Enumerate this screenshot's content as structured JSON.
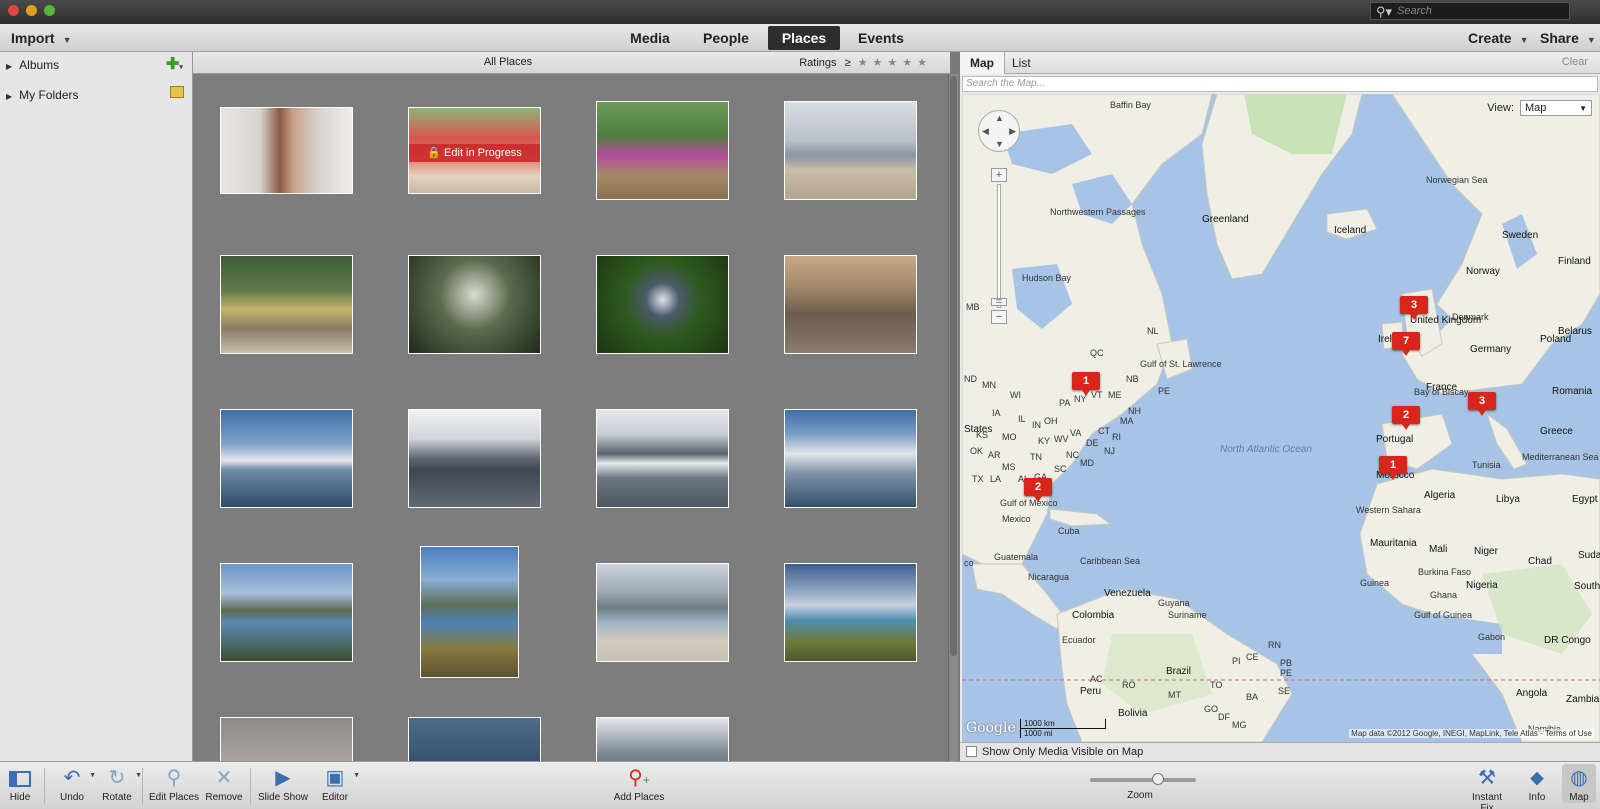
{
  "titlebar": {
    "search_placeholder": "Search"
  },
  "menubar": {
    "import": "Import",
    "tabs": [
      "Media",
      "People",
      "Places",
      "Events"
    ],
    "active_tab": "Places",
    "create": "Create",
    "share": "Share"
  },
  "sidebar": {
    "albums": "Albums",
    "my_folders": "My Folders"
  },
  "grid": {
    "title": "All Places",
    "ratings_label": "Ratings",
    "ratings_op": "≥",
    "stars": "★★★★★",
    "edit_badge": "Edit in Progress"
  },
  "map": {
    "tabs": [
      "Map",
      "List"
    ],
    "clear": "Clear",
    "search_placeholder": "Search the Map...",
    "view_label": "View:",
    "view_value": "Map",
    "labels": {
      "greenland": "Greenland",
      "iceland": "Iceland",
      "sweden": "Sweden",
      "finland": "Finland",
      "norway": "Norway",
      "denmark": "Denmark",
      "united_kingdom": "United Kingdom",
      "ireland": "Ireland",
      "germany": "Germany",
      "poland": "Poland",
      "belarus": "Belarus",
      "france": "France",
      "romania": "Romania",
      "portugal": "Portugal",
      "greece": "Greece",
      "tunisia": "Tunisia",
      "morocco": "Morocco",
      "algeria": "Algeria",
      "libya": "Libya",
      "egypt": "Egypt",
      "western_sahara": "Western Sahara",
      "mauritania": "Mauritania",
      "mali": "Mali",
      "niger": "Niger",
      "chad": "Chad",
      "sudan": "Sudan",
      "south_sudan": "South Sudan",
      "burkina_faso": "Burkina Faso",
      "ghana": "Ghana",
      "nigeria": "Nigeria",
      "guinea": "Guinea",
      "gabon": "Gabon",
      "dr_congo": "DR Congo",
      "angola": "Angola",
      "zambia": "Zambia",
      "namibia": "Namibia",
      "states": "States",
      "mexico": "Mexico",
      "cuba": "Cuba",
      "guatemala": "Guatemala",
      "nicaragua": "Nicaragua",
      "venezuela": "Venezuela",
      "colombia": "Colombia",
      "guyana": "Guyana",
      "suriname": "Suriname",
      "ecuador": "Ecuador",
      "peru": "Peru",
      "brazil": "Brazil",
      "bolivia": "Bolivia",
      "hudson_bay": "Hudson Bay",
      "baffin_bay": "Baffin Bay",
      "northwest_passages": "Northwestern Passages",
      "norwegian_sea": "Norwegian Sea",
      "bay_of_biscay": "Bay of Biscay",
      "gulf_st": "Gulf of St. Lawrence",
      "gulf_mexico": "Gulf of Mexico",
      "caribbean": "Caribbean Sea",
      "gulf_guinea": "Gulf of Guinea",
      "north_atlantic": "North Atlantic Ocean",
      "qc": "QC",
      "nl": "NL",
      "nb": "NB",
      "pe": "PE",
      "vt": "VT",
      "me": "ME",
      "nh": "NH",
      "ma": "MA",
      "ny": "NY",
      "wi": "WI",
      "il": "IL",
      "in": "IN",
      "oh": "OH",
      "wv": "WV",
      "va": "VA",
      "ky": "KY",
      "nc": "NC",
      "sc": "SC",
      "tn": "TN",
      "ga": "GA",
      "al": "AL",
      "ms": "MS",
      "la": "LA",
      "ar": "AR",
      "mo": "MO",
      "ia": "IA",
      "tx": "TX",
      "ks": "KS",
      "nd": "ND",
      "mn": "MN",
      "mb": "MB",
      "pa": "PA",
      "nj": "NJ",
      "de": "DE",
      "md": "MD",
      "ct": "CT",
      "ri": "RI",
      "ok": "OK",
      "co": "co",
      "med_sea": "Mediterranean Sea",
      "rn": "RN",
      "pb": "PB",
      "pe2": "PE",
      "ce": "CE",
      "pi": "PI",
      "to": "TO",
      "ba": "BA",
      "mt": "MT",
      "go": "GO",
      "df": "DF",
      "mg": "MG",
      "ro": "RO",
      "ac": "AC",
      "se": "SE"
    },
    "pins": [
      "3",
      "7",
      "1",
      "2",
      "3",
      "2",
      "1"
    ],
    "google": "Google",
    "scale_km": "1000 km",
    "scale_mi": "1000 mi",
    "attribution": "Map data ©2012 Google, INEGI, MapLink, Tele Atlas - Terms of Use",
    "show_only_visible": "Show Only Media Visible on Map"
  },
  "toolbar": {
    "hide": "Hide",
    "undo": "Undo",
    "rotate": "Rotate",
    "edit_places": "Edit Places",
    "remove": "Remove",
    "slide_show": "Slide Show",
    "editor": "Editor",
    "add_places": "Add Places",
    "zoom": "Zoom",
    "instant_fix": "Instant Fix",
    "info": "Info",
    "map": "Map"
  },
  "colors": {
    "accent": "#3a6fb4",
    "pin": "#d8261c",
    "sea": "#a7c4e6",
    "land": "#efefe6"
  }
}
